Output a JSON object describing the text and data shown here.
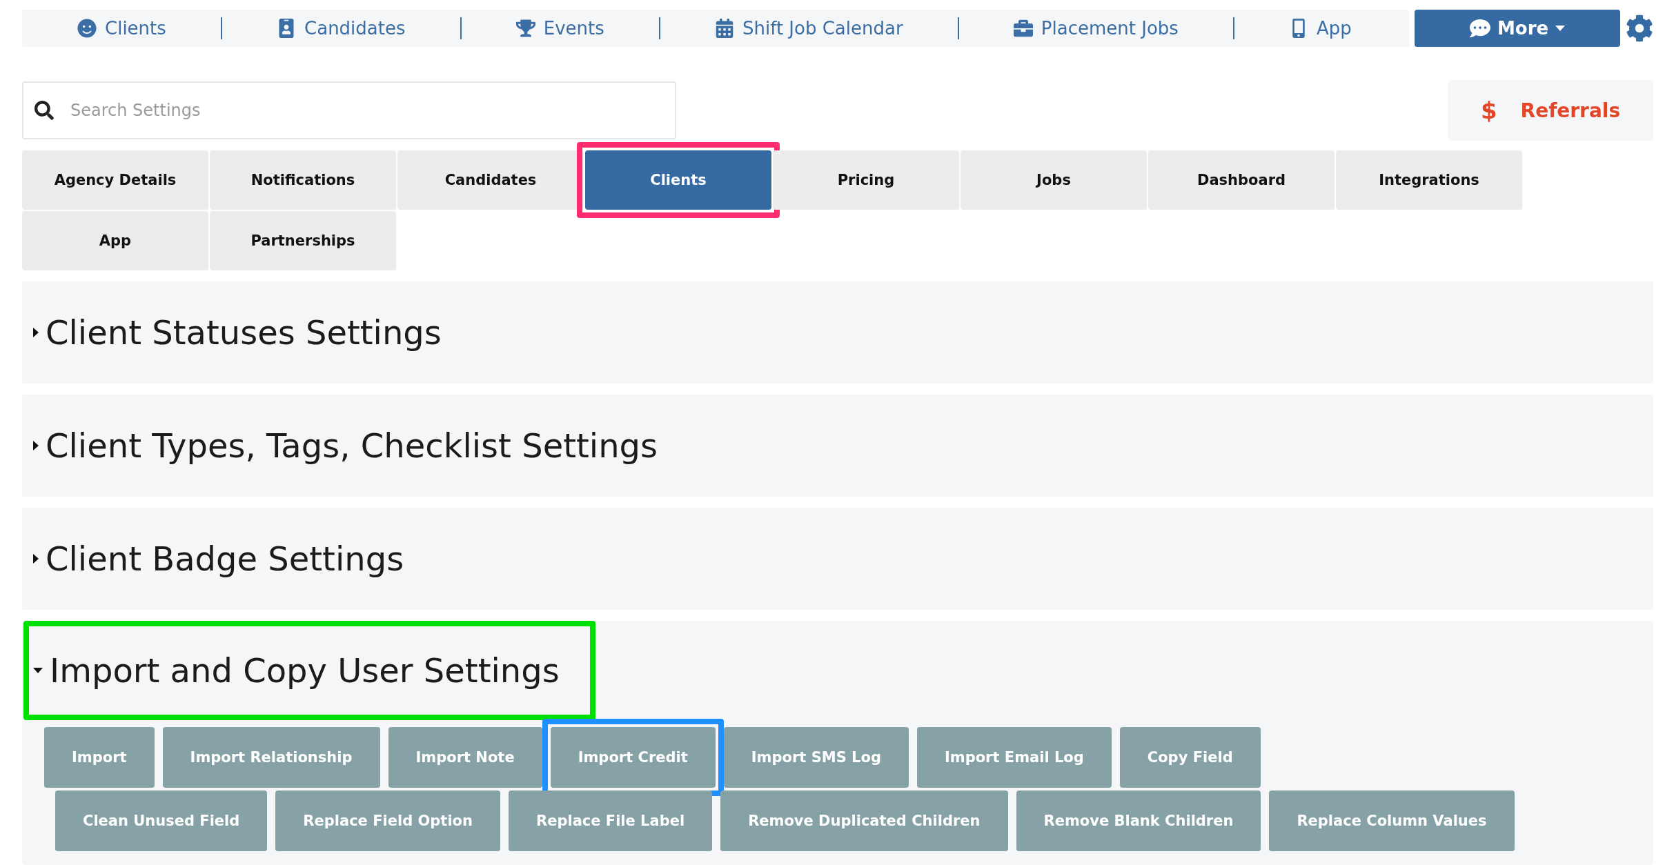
{
  "nav": {
    "items": [
      {
        "label": "Clients"
      },
      {
        "label": "Candidates"
      },
      {
        "label": "Events"
      },
      {
        "label": "Shift Job Calendar"
      },
      {
        "label": "Placement Jobs"
      },
      {
        "label": "App"
      }
    ],
    "more": "More"
  },
  "search": {
    "placeholder": "Search Settings"
  },
  "referrals": {
    "symbol": "$",
    "label": "Referrals"
  },
  "tabs": [
    {
      "label": "Agency Details",
      "selected": false,
      "highlighted": false
    },
    {
      "label": "Notifications",
      "selected": false,
      "highlighted": false
    },
    {
      "label": "Candidates",
      "selected": false,
      "highlighted": false
    },
    {
      "label": "Clients",
      "selected": true,
      "highlighted": true
    },
    {
      "label": "Pricing",
      "selected": false,
      "highlighted": false
    },
    {
      "label": "Jobs",
      "selected": false,
      "highlighted": false
    },
    {
      "label": "Dashboard",
      "selected": false,
      "highlighted": false
    },
    {
      "label": "Integrations",
      "selected": false,
      "highlighted": false
    },
    {
      "label": "App",
      "selected": false,
      "highlighted": false
    },
    {
      "label": "Partnerships",
      "selected": false,
      "highlighted": false
    }
  ],
  "sections": [
    {
      "title": "Client Statuses Settings",
      "expanded": false,
      "highlighted": false
    },
    {
      "title": "Client Types, Tags, Checklist Settings",
      "expanded": false,
      "highlighted": false
    },
    {
      "title": "Client Badge Settings",
      "expanded": false,
      "highlighted": false
    },
    {
      "title": "Import and Copy User Settings",
      "expanded": true,
      "highlighted": true,
      "button_rows": [
        {
          "buttons": [
            {
              "label": "Import",
              "highlighted": false
            },
            {
              "label": "Import Relationship",
              "highlighted": false
            },
            {
              "label": "Import Note",
              "highlighted": false
            },
            {
              "label": "Import Credit",
              "highlighted": true
            },
            {
              "label": "Import SMS Log",
              "highlighted": false
            },
            {
              "label": "Import Email Log",
              "highlighted": false
            },
            {
              "label": "Copy Field",
              "highlighted": false
            }
          ]
        },
        {
          "buttons": [
            {
              "label": "Clean Unused Field",
              "highlighted": false
            },
            {
              "label": "Replace Field Option",
              "highlighted": false
            },
            {
              "label": "Replace File Label",
              "highlighted": false
            },
            {
              "label": "Remove Duplicated Children",
              "highlighted": false
            },
            {
              "label": "Remove Blank Children",
              "highlighted": false
            },
            {
              "label": "Replace Column Values",
              "highlighted": false
            }
          ]
        }
      ]
    }
  ]
}
